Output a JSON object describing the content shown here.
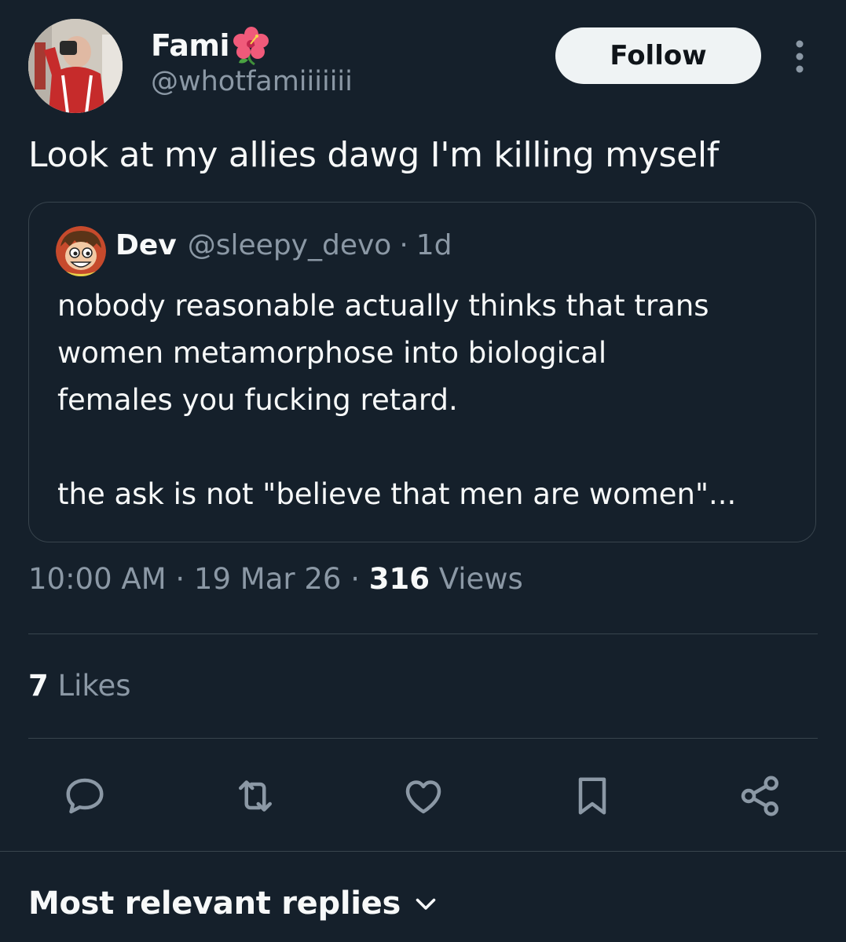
{
  "author": {
    "display_name": "Fami",
    "handle": "@whotfamiiiiiii"
  },
  "follow_button": {
    "label": "Follow"
  },
  "tweet": {
    "text": "Look at my allies dawg I'm killing myself",
    "time": "10:00 AM",
    "date": "19 Mar 26",
    "views_count": "316",
    "views_label": "Views",
    "separator": "·"
  },
  "quote": {
    "name": "Dev",
    "handle": "@sleepy_devo",
    "separator": "·",
    "age": "1d",
    "body": "nobody reasonable actually thinks that trans\nwomen metamorphose into biological\nfemales you fucking retard.\n\nthe ask is not \"believe that men are women\"..."
  },
  "likes": {
    "count": "7",
    "label": "Likes"
  },
  "actions": [
    "reply-icon",
    "retweet-icon",
    "like-icon",
    "bookmark-icon",
    "share-icon"
  ],
  "replies": {
    "title": "Most relevant replies"
  },
  "colors": {
    "background": "#15202b",
    "text_primary": "#f7f9f9",
    "text_secondary": "#8b98a5",
    "border": "#38444d",
    "follow_bg": "#eff3f4"
  }
}
